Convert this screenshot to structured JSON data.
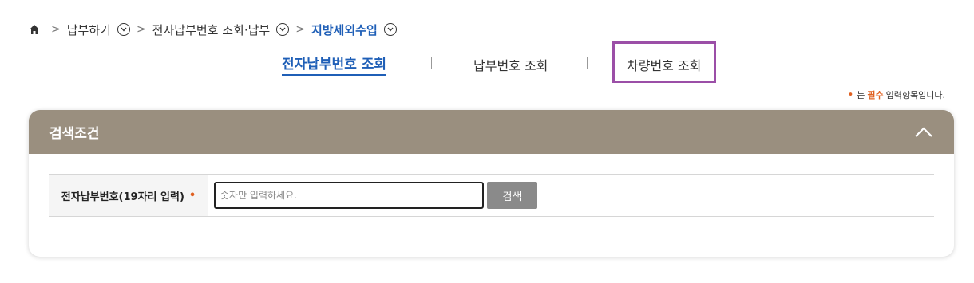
{
  "breadcrumb": {
    "home_icon": "home-icon",
    "items": [
      "납부하기",
      "전자납부번호 조회·납부",
      "지방세외수입"
    ]
  },
  "tabs": [
    {
      "label": "전자납부번호 조회",
      "active": true
    },
    {
      "label": "납부번호 조회",
      "active": false
    },
    {
      "label": "차량번호 조회",
      "active": false,
      "highlighted": true
    }
  ],
  "required_note": {
    "prefix": "는",
    "keyword": "필수",
    "suffix": "입력항목입니다."
  },
  "panel": {
    "title": "검색조건",
    "collapse_icon": "chevron-up-icon",
    "header_color": "#9a8f7f"
  },
  "search": {
    "label": "전자납부번호(19자리 입력)",
    "required_mark": "•",
    "placeholder": "숫자만 입력하세요.",
    "value": "",
    "button_label": "검색"
  },
  "colors": {
    "accent": "#1f5fb7",
    "required": "#e06020",
    "highlight_box": "#9b4fa7"
  }
}
